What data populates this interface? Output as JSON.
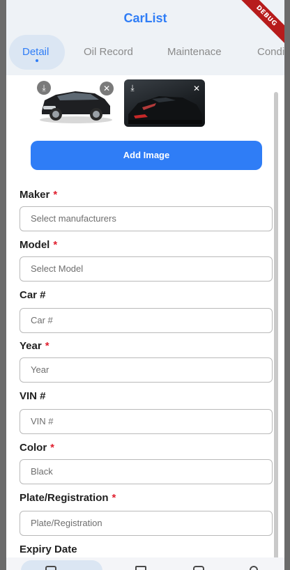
{
  "app": {
    "title": "CarList",
    "debug_banner": "DEBUG"
  },
  "tabs": [
    {
      "label": "Detail",
      "active": true
    },
    {
      "label": "Oil Record",
      "active": false
    },
    {
      "label": "Maintenace",
      "active": false
    },
    {
      "label": "Condi",
      "active": false
    }
  ],
  "images": {
    "thumbnails": [
      {
        "icon_download": "download-icon",
        "icon_remove": "close-icon"
      },
      {
        "icon_download": "download-icon",
        "icon_remove": "close-icon"
      }
    ],
    "add_button_label": "Add Image"
  },
  "form": {
    "maker": {
      "label": "Maker",
      "required_mark": "*",
      "placeholder": "Select manufacturers"
    },
    "model": {
      "label": "Model",
      "required_mark": "*",
      "placeholder": "Select Model"
    },
    "car_number": {
      "label": "Car #",
      "placeholder": "Car #"
    },
    "year": {
      "label": "Year",
      "required_mark": "*",
      "placeholder": "Year"
    },
    "vin": {
      "label": "VIN #",
      "placeholder": "VIN #"
    },
    "color": {
      "label": "Color",
      "required_mark": "*",
      "value": "Black"
    },
    "plate": {
      "label": "Plate/Registration",
      "required_mark": "*",
      "placeholder": "Plate/Registration"
    },
    "expiry": {
      "label": "Expiry Date"
    }
  },
  "colors": {
    "accent": "#2f7df6",
    "required": "#e0202f",
    "appbar_bg": "#eef2f6"
  }
}
